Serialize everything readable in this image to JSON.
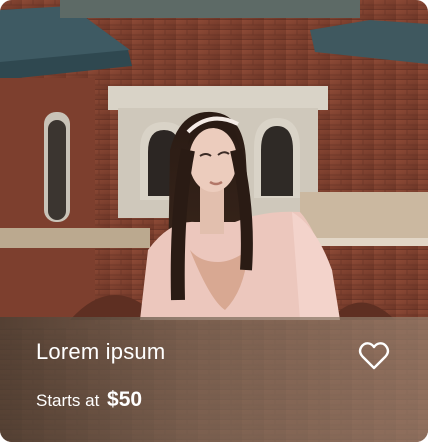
{
  "card": {
    "title": "Lorem ipsum",
    "price_prefix": "Starts at",
    "price_value": "$50",
    "favorite_icon": "heart-outline-icon",
    "image_subject": "woman-in-pink-outfit-brick-house"
  },
  "colors": {
    "text": "#ffffff",
    "overlay_start": "#4a4034",
    "overlay_end": "#968270",
    "brick": "#7a3a2a",
    "jacket": "#f0c9c0"
  }
}
